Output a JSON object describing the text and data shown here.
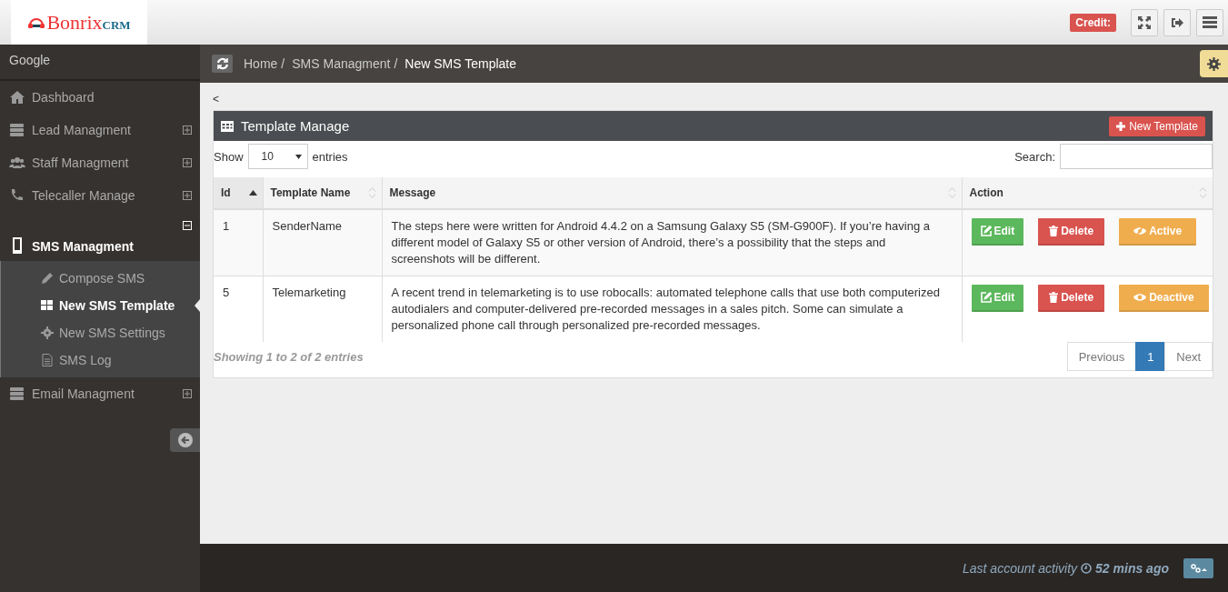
{
  "header": {
    "logo": {
      "main": "Bonrix",
      "suffix": "CRM"
    },
    "credit_badge": "Credit:"
  },
  "sidebar": {
    "account": "Google",
    "items": [
      {
        "label": "Dashboard"
      },
      {
        "label": "Lead Managment",
        "expanded": false
      },
      {
        "label": "Staff Managment",
        "expanded": false
      },
      {
        "label": "Telecaller Manage",
        "expanded": false
      },
      {
        "label": "SMS Managment",
        "expanded": true,
        "children": [
          {
            "label": "Compose SMS",
            "selected": false
          },
          {
            "label": "New SMS Template",
            "selected": true
          },
          {
            "label": "New SMS Settings",
            "selected": false
          },
          {
            "label": "SMS Log",
            "selected": false
          }
        ]
      },
      {
        "label": "Email Managment",
        "expanded": false
      }
    ]
  },
  "breadcrumb": [
    {
      "label": "Home",
      "separator": "/",
      "current": false
    },
    {
      "label": "SMS Managment",
      "separator": "/",
      "current": false
    },
    {
      "label": "New SMS Template",
      "current": true
    }
  ],
  "back_link": "<",
  "panel": {
    "title": "Template Manage",
    "new_button": "New Template",
    "show_label": "Show",
    "page_size": "10",
    "entries_label": "entries",
    "search_label": "Search:",
    "columns": [
      {
        "label": "Id",
        "sorted": true
      },
      {
        "label": "Template Name",
        "sorted": false
      },
      {
        "label": "Message",
        "sorted": false
      },
      {
        "label": "Action",
        "sorted": false
      }
    ],
    "rows": [
      {
        "id": "1",
        "name": "SenderName",
        "message": "The steps here were written for Android 4.4.2 on a Samsung Galaxy S5 (SM-G900F). If you’re having a different model of Galaxy S5 or other version of Android, there’s a possibility that the steps and screenshots will be different.",
        "edit": "Edit",
        "delete": "Delete",
        "status": {
          "label": "Active",
          "kind": "hidden"
        }
      },
      {
        "id": "5",
        "name": "Telemarketing",
        "message": "A recent trend in telemarketing is to use robocalls: automated telephone calls that use both computerized autodialers and computer-delivered pre-recorded messages in a sales pitch. Some can simulate a personalized phone call through personalized pre-recorded messages.",
        "edit": "Edit",
        "delete": "Delete",
        "status": {
          "label": "Deactive",
          "kind": "visible"
        }
      }
    ],
    "info": "Showing 1 to 2 of 2 entries",
    "pagination": [
      {
        "label": "Previous",
        "selected": false
      },
      {
        "label": "1",
        "selected": true
      },
      {
        "label": "Next",
        "selected": false
      }
    ]
  },
  "footer": {
    "activity_label": "Last account activity",
    "activity_time": "52 mins ago"
  }
}
